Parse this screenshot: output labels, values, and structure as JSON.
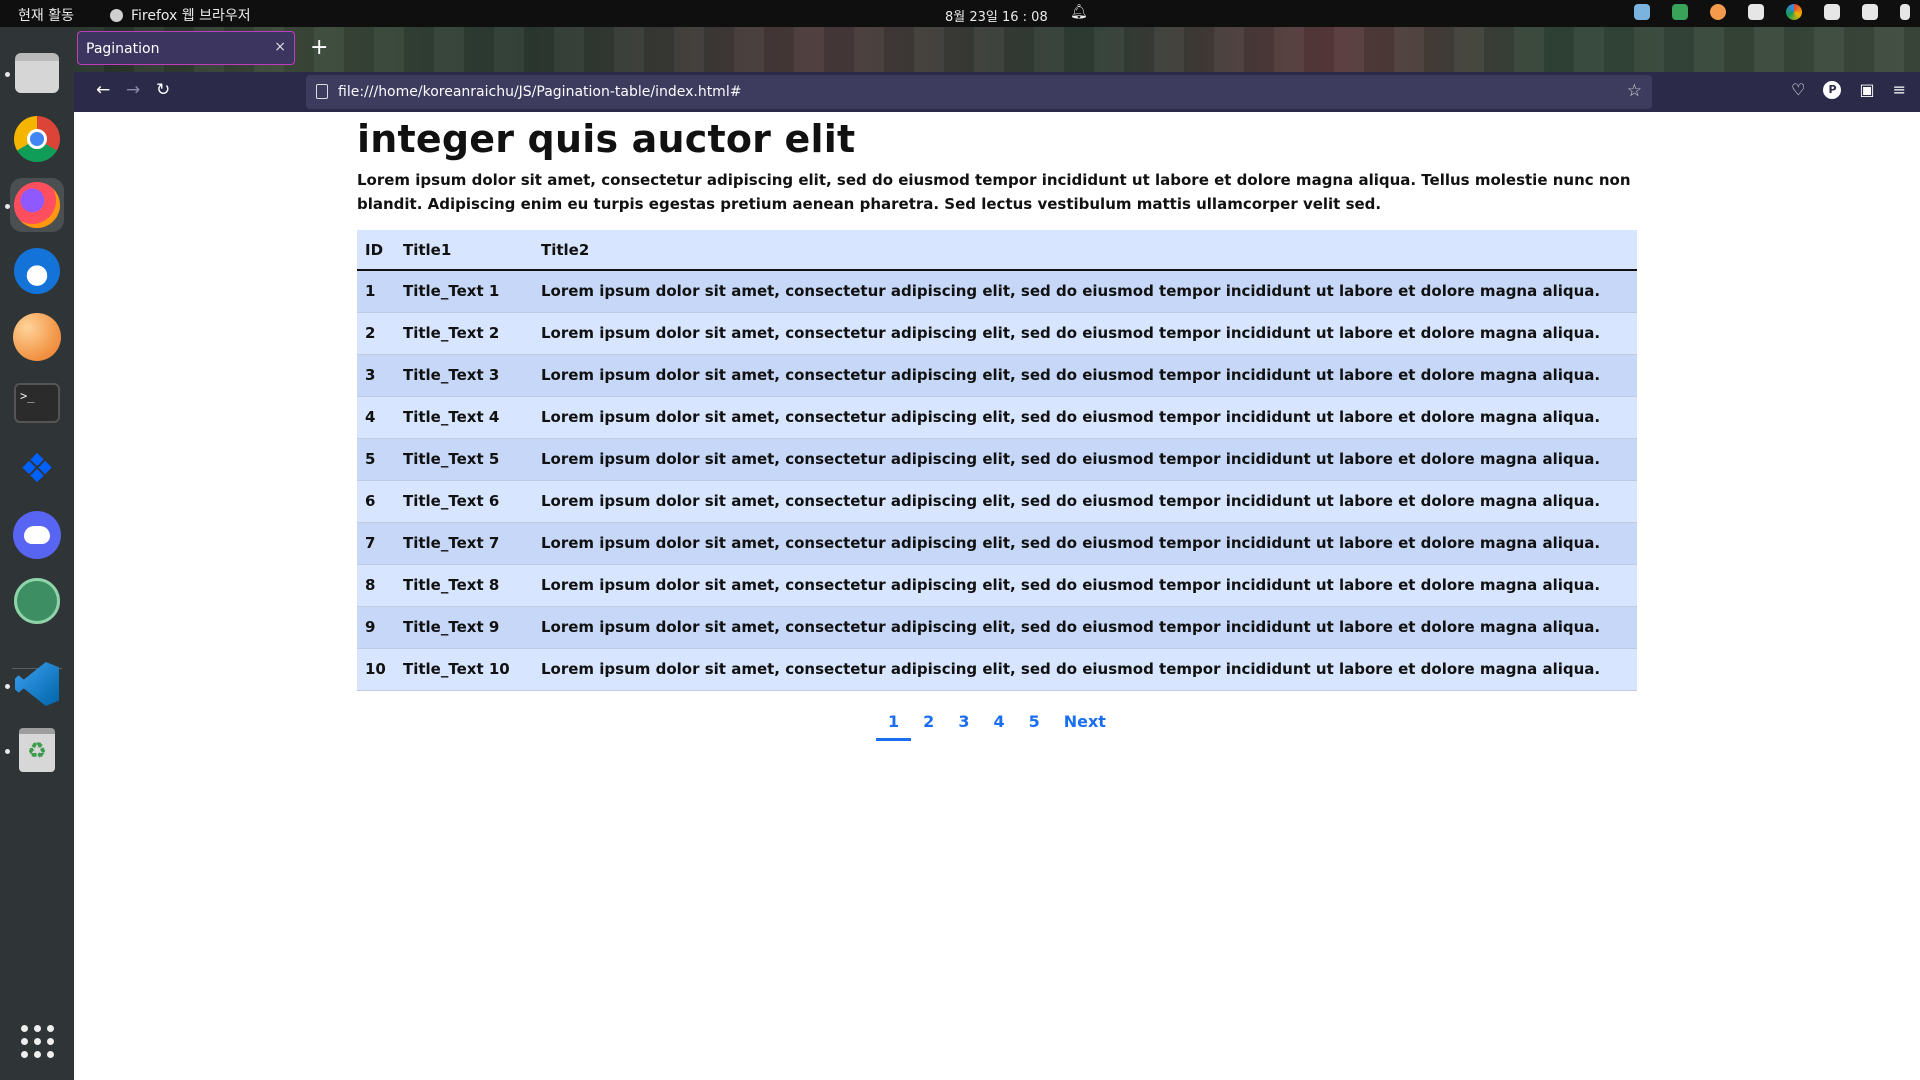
{
  "system": {
    "activities": "현재 활동",
    "app_name": "Firefox 웹 브라우저",
    "clock": "8월 23일  16 : 08"
  },
  "browser": {
    "tab_title": "Pagination",
    "tab_close": "×",
    "new_tab": "+",
    "url": "file:///home/koreanraichu/JS/Pagination-table/index.html#",
    "back": "←",
    "forward": "→",
    "reload": "↻",
    "bookmark": "☆",
    "menu": "≡"
  },
  "page": {
    "title": "integer quis auctor elit",
    "intro": "Lorem ipsum dolor sit amet, consectetur adipiscing elit, sed do eiusmod tempor incididunt ut labore et dolore magna aliqua. Tellus molestie nunc non blandit. Adipiscing enim eu turpis egestas pretium aenean pharetra. Sed lectus vestibulum mattis ullamcorper velit sed.",
    "table": {
      "headers": [
        "ID",
        "Title1",
        "Title2"
      ],
      "rows": [
        [
          "1",
          "Title_Text 1",
          "Lorem ipsum dolor sit amet, consectetur adipiscing elit, sed do eiusmod tempor incididunt ut labore et dolore magna aliqua."
        ],
        [
          "2",
          "Title_Text 2",
          "Lorem ipsum dolor sit amet, consectetur adipiscing elit, sed do eiusmod tempor incididunt ut labore et dolore magna aliqua."
        ],
        [
          "3",
          "Title_Text 3",
          "Lorem ipsum dolor sit amet, consectetur adipiscing elit, sed do eiusmod tempor incididunt ut labore et dolore magna aliqua."
        ],
        [
          "4",
          "Title_Text 4",
          "Lorem ipsum dolor sit amet, consectetur adipiscing elit, sed do eiusmod tempor incididunt ut labore et dolore magna aliqua."
        ],
        [
          "5",
          "Title_Text 5",
          "Lorem ipsum dolor sit amet, consectetur adipiscing elit, sed do eiusmod tempor incididunt ut labore et dolore magna aliqua."
        ],
        [
          "6",
          "Title_Text 6",
          "Lorem ipsum dolor sit amet, consectetur adipiscing elit, sed do eiusmod tempor incididunt ut labore et dolore magna aliqua."
        ],
        [
          "7",
          "Title_Text 7",
          "Lorem ipsum dolor sit amet, consectetur adipiscing elit, sed do eiusmod tempor incididunt ut labore et dolore magna aliqua."
        ],
        [
          "8",
          "Title_Text 8",
          "Lorem ipsum dolor sit amet, consectetur adipiscing elit, sed do eiusmod tempor incididunt ut labore et dolore magna aliqua."
        ],
        [
          "9",
          "Title_Text 9",
          "Lorem ipsum dolor sit amet, consectetur adipiscing elit, sed do eiusmod tempor incididunt ut labore et dolore magna aliqua."
        ],
        [
          "10",
          "Title_Text 10",
          "Lorem ipsum dolor sit amet, consectetur adipiscing elit, sed do eiusmod tempor incididunt ut labore et dolore magna aliqua."
        ]
      ]
    },
    "pagination": {
      "pages": [
        "1",
        "2",
        "3",
        "4",
        "5"
      ],
      "current": "1",
      "next": "Next"
    }
  },
  "colors": {
    "accent": "#1a6ff0",
    "row_odd": "#c6d7f7",
    "row_even": "#d7e5fe"
  }
}
